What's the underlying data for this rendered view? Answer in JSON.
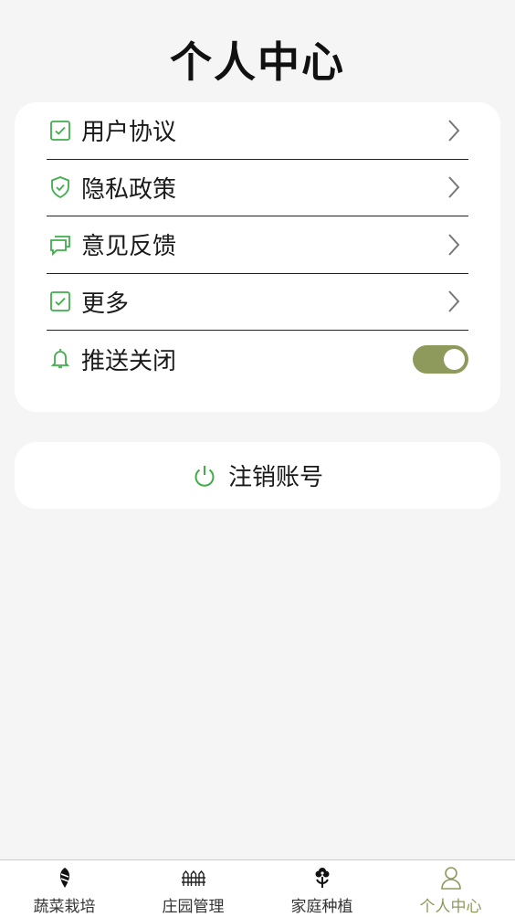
{
  "page": {
    "title": "个人中心"
  },
  "colors": {
    "accent_green": "#3fae49",
    "toggle_olive": "#8d9a5b",
    "active_tab": "#8d9a5b"
  },
  "menu": {
    "items": [
      {
        "label": "用户协议",
        "icon": "checkbox-icon"
      },
      {
        "label": "隐私政策",
        "icon": "shield-check-icon"
      },
      {
        "label": "意见反馈",
        "icon": "chat-bubbles-icon"
      },
      {
        "label": "更多",
        "icon": "checkbox-icon"
      }
    ],
    "push": {
      "label": "推送关闭",
      "icon": "bell-icon",
      "toggle_on": true
    }
  },
  "logout": {
    "label": "注销账号",
    "icon": "power-icon"
  },
  "tabbar": {
    "tabs": [
      {
        "label": "蔬菜栽培",
        "icon": "vegetable-icon",
        "active": false
      },
      {
        "label": "庄园管理",
        "icon": "fence-icon",
        "active": false
      },
      {
        "label": "家庭种植",
        "icon": "flower-icon",
        "active": false
      },
      {
        "label": "个人中心",
        "icon": "person-icon",
        "active": true
      }
    ]
  }
}
